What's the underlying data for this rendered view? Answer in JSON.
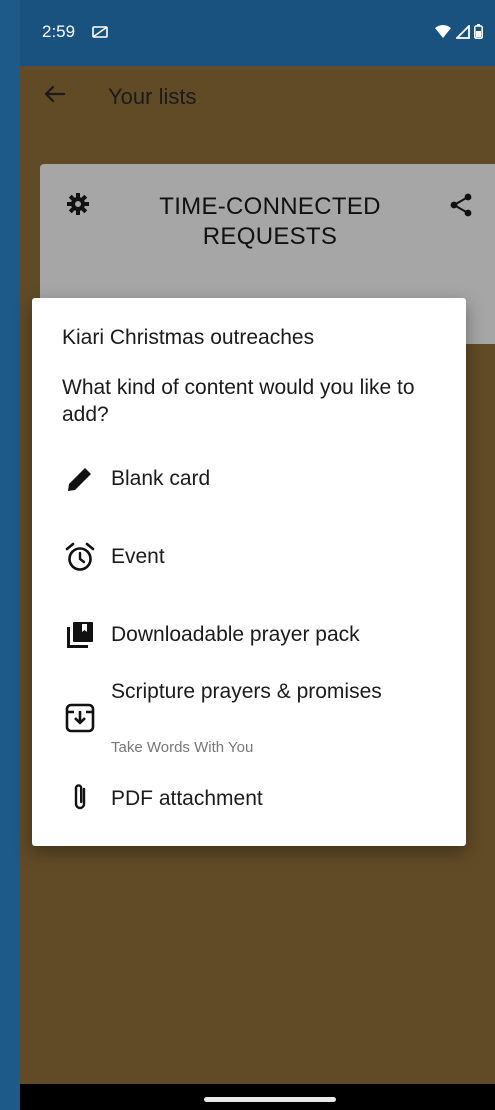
{
  "status": {
    "time": "2:59"
  },
  "app_bar": {
    "title": "Your lists"
  },
  "card": {
    "title": "TIME-CONNECTED REQUESTS"
  },
  "dialog": {
    "title": "Kiari Christmas outreaches",
    "question": "What kind of content would you like to add?",
    "options": [
      {
        "label": "Blank card",
        "icon": "pencil-icon"
      },
      {
        "label": "Event",
        "icon": "alarm-clock-icon"
      },
      {
        "label": "Downloadable prayer pack",
        "icon": "library-icon"
      },
      {
        "label": "Scripture prayers & promises",
        "sublabel": "Take Words With You",
        "icon": "download-box-icon"
      },
      {
        "label": "PDF attachment",
        "icon": "paperclip-icon"
      }
    ]
  },
  "colors": {
    "background": "#614b27",
    "status_bar": "#19527f",
    "card": "#a6a6a6",
    "dialog": "#ffffff"
  }
}
